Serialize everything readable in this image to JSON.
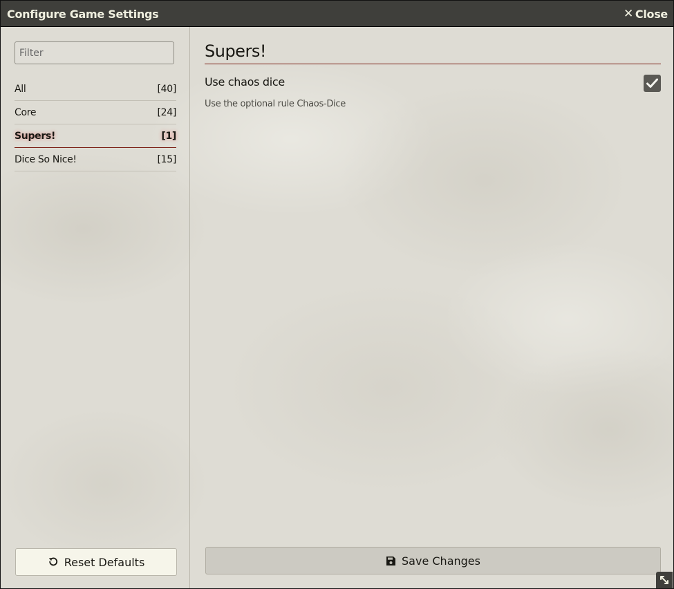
{
  "window": {
    "title": "Configure Game Settings",
    "close_label": "Close"
  },
  "sidebar": {
    "filter_placeholder": "Filter",
    "categories": [
      {
        "label": "All",
        "count": "[40]"
      },
      {
        "label": "Core",
        "count": "[24]"
      },
      {
        "label": "Supers!",
        "count": "[1]",
        "active": true
      },
      {
        "label": "Dice So Nice!",
        "count": "[15]"
      }
    ],
    "reset_label": "Reset Defaults"
  },
  "main": {
    "section_title": "Supers!",
    "settings": [
      {
        "label": "Use chaos dice",
        "hint": "Use the optional rule Chaos-Dice",
        "checked": true
      }
    ],
    "save_label": "Save Changes"
  },
  "icons": {
    "close": "close-icon",
    "reset": "undo-icon",
    "save": "save-icon",
    "check": "check-icon",
    "resize": "resize-icon"
  },
  "colors": {
    "titlebar": "#3f3f3b",
    "accent_border": "#7a1d12",
    "checkbox": "#5a5954"
  }
}
